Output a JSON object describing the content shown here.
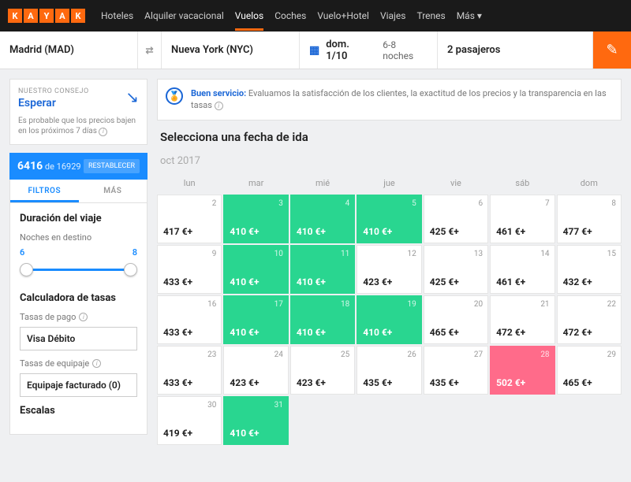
{
  "logo": [
    "K",
    "A",
    "Y",
    "A",
    "K"
  ],
  "nav": [
    {
      "label": "Hoteles"
    },
    {
      "label": "Alquiler vacacional"
    },
    {
      "label": "Vuelos",
      "active": true
    },
    {
      "label": "Coches"
    },
    {
      "label": "Vuelo+Hotel"
    },
    {
      "label": "Viajes"
    },
    {
      "label": "Trenes"
    },
    {
      "label": "Más ▾"
    }
  ],
  "search": {
    "origin": "Madrid (MAD)",
    "destination": "Nueva York (NYC)",
    "date": "dom. 1/10",
    "nights": "6-8 noches",
    "passengers": "2 pasajeros"
  },
  "advice": {
    "label": "NUESTRO CONSEJO",
    "action": "Esperar",
    "text": "Es probable que los precios bajen en los próximos 7 días"
  },
  "counter": {
    "shown": "6416",
    "total": "16929",
    "of": "de",
    "reset": "RESTABLECER"
  },
  "tabs": {
    "filtros": "FILTROS",
    "mas": "MÁS"
  },
  "duration": {
    "title": "Duración del viaje",
    "nights_label": "Noches en destino",
    "min": "6",
    "max": "8"
  },
  "fees": {
    "title": "Calculadora de tasas",
    "pay_label": "Tasas de pago",
    "pay_value": "Visa Débito",
    "bag_label": "Tasas de equipaje",
    "bag_value": "Equipaje facturado (0)"
  },
  "stops": {
    "title": "Escalas"
  },
  "banner": {
    "bold": "Buen servicio:",
    "text": "Evaluamos la satisfacción de los clientes, la exactitud de los precios y la transparencia en las tasas"
  },
  "prompt": "Selecciona una fecha de ida",
  "month": "oct 2017",
  "weekdays": [
    "lun",
    "mar",
    "mié",
    "jue",
    "vie",
    "sáb",
    "dom"
  ],
  "cells": [
    {
      "day": "2",
      "price": "417 €+"
    },
    {
      "day": "3",
      "price": "410 €+",
      "c": "green"
    },
    {
      "day": "4",
      "price": "410 €+",
      "c": "green"
    },
    {
      "day": "5",
      "price": "410 €+",
      "c": "green"
    },
    {
      "day": "6",
      "price": "425 €+"
    },
    {
      "day": "7",
      "price": "461 €+"
    },
    {
      "day": "8",
      "price": "477 €+"
    },
    {
      "day": "9",
      "price": "433 €+"
    },
    {
      "day": "10",
      "price": "410 €+",
      "c": "green"
    },
    {
      "day": "11",
      "price": "410 €+",
      "c": "green"
    },
    {
      "day": "12",
      "price": "423 €+"
    },
    {
      "day": "13",
      "price": "425 €+"
    },
    {
      "day": "14",
      "price": "461 €+"
    },
    {
      "day": "15",
      "price": "432 €+"
    },
    {
      "day": "16",
      "price": "433 €+"
    },
    {
      "day": "17",
      "price": "410 €+",
      "c": "green"
    },
    {
      "day": "18",
      "price": "410 €+",
      "c": "green"
    },
    {
      "day": "19",
      "price": "410 €+",
      "c": "green"
    },
    {
      "day": "20",
      "price": "465 €+"
    },
    {
      "day": "21",
      "price": "472 €+"
    },
    {
      "day": "22",
      "price": "472 €+"
    },
    {
      "day": "23",
      "price": "433 €+"
    },
    {
      "day": "24",
      "price": "423 €+"
    },
    {
      "day": "25",
      "price": "423 €+"
    },
    {
      "day": "26",
      "price": "435 €+"
    },
    {
      "day": "27",
      "price": "435 €+"
    },
    {
      "day": "28",
      "price": "502 €+",
      "c": "pink"
    },
    {
      "day": "29",
      "price": "465 €+"
    },
    {
      "day": "30",
      "price": "419 €+"
    },
    {
      "day": "31",
      "price": "410 €+",
      "c": "green"
    }
  ]
}
